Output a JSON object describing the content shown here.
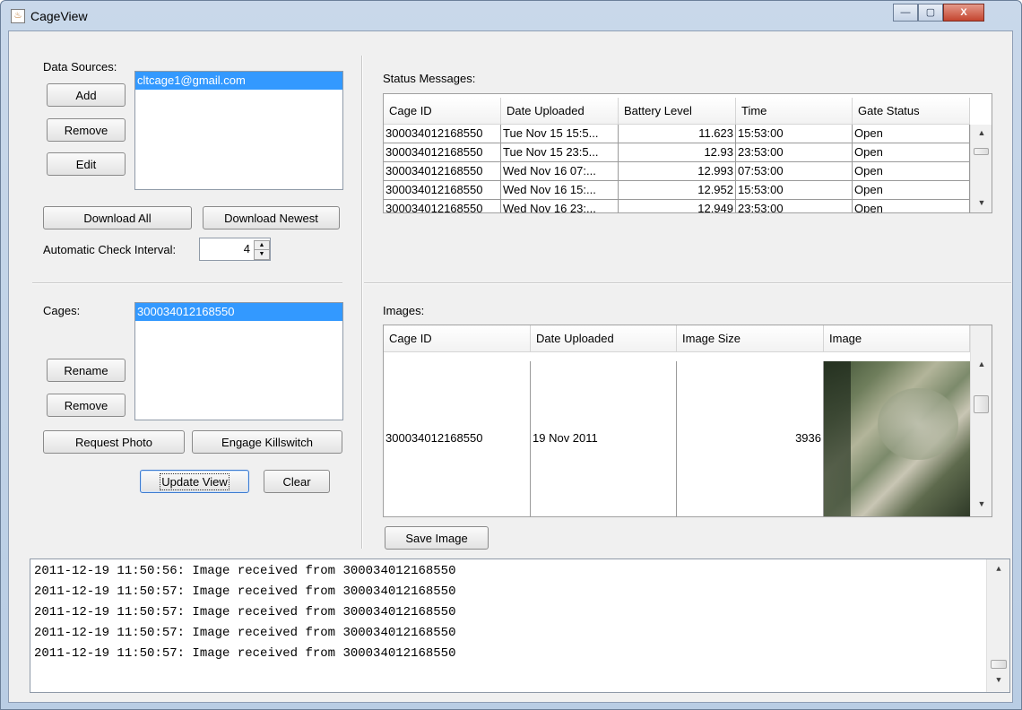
{
  "window": {
    "title": "CageView",
    "minimize_glyph": "—",
    "maximize_glyph": "▢",
    "close_glyph": "X",
    "app_icon": "java-icon"
  },
  "data_sources": {
    "label": "Data Sources:",
    "items": [
      "cltcage1@gmail.com"
    ],
    "selected_index": 0,
    "add_label": "Add",
    "remove_label": "Remove",
    "edit_label": "Edit",
    "download_all_label": "Download All",
    "download_newest_label": "Download Newest",
    "interval_label": "Automatic Check Interval:",
    "interval_value": "4"
  },
  "cages": {
    "label": "Cages:",
    "items": [
      "300034012168550"
    ],
    "selected_index": 0,
    "rename_label": "Rename",
    "remove_label": "Remove",
    "request_photo_label": "Request Photo",
    "killswitch_label": "Engage Killswitch",
    "update_view_label": "Update View",
    "clear_label": "Clear"
  },
  "status_messages": {
    "label": "Status Messages:",
    "columns": [
      "Cage ID",
      "Date Uploaded",
      "Battery Level",
      "Time",
      "Gate Status"
    ],
    "rows": [
      [
        "300034012168550",
        "Tue Nov 15 15:5...",
        "11.623",
        "15:53:00",
        "Open"
      ],
      [
        "300034012168550",
        "Tue Nov 15 23:5...",
        "12.93",
        "23:53:00",
        "Open"
      ],
      [
        "300034012168550",
        "Wed Nov 16 07:...",
        "12.993",
        "07:53:00",
        "Open"
      ],
      [
        "300034012168550",
        "Wed Nov 16 15:...",
        "12.952",
        "15:53:00",
        "Open"
      ],
      [
        "300034012168550",
        "Wed Nov 16 23:...",
        "12.949",
        "23:53:00",
        "Open"
      ]
    ]
  },
  "images": {
    "label": "Images:",
    "columns": [
      "Cage ID",
      "Date Uploaded",
      "Image Size",
      "Image"
    ],
    "rows": [
      {
        "cage_id": "300034012168550",
        "date": "19 Nov 2011",
        "size": "3936"
      }
    ],
    "save_label": "Save Image"
  },
  "log": {
    "lines": [
      "2011-12-19 11:50:56: Image received from 300034012168550",
      "2011-12-19 11:50:57: Image received from 300034012168550",
      "2011-12-19 11:50:57: Image received from 300034012168550",
      "2011-12-19 11:50:57: Image received from 300034012168550",
      "2011-12-19 11:50:57: Image received from 300034012168550"
    ]
  },
  "colors": {
    "selection": "#3399ff",
    "panel": "#f0f0f0",
    "titlebar": "#c9d8ea",
    "close_button": "#c4452f"
  }
}
